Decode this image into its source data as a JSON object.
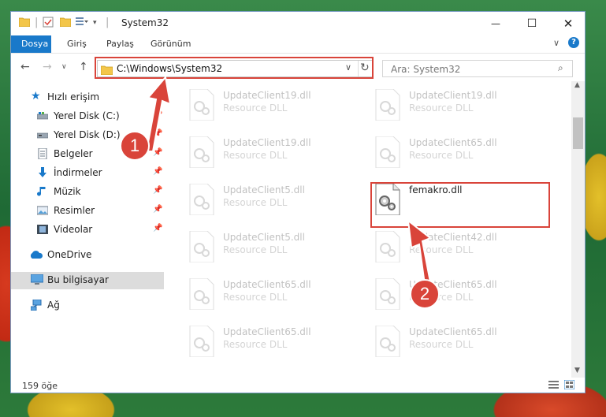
{
  "window": {
    "title": "System32",
    "minimize": "—",
    "maximize": "☐",
    "close": "✕"
  },
  "ribbon": {
    "tabs": [
      {
        "label": "Dosya",
        "active": true
      },
      {
        "label": "Giriş",
        "active": false
      },
      {
        "label": "Paylaş",
        "active": false
      },
      {
        "label": "Görünüm",
        "active": false
      }
    ]
  },
  "address": {
    "path": "C:\\Windows\\System32"
  },
  "search": {
    "placeholder": "Ara: System32"
  },
  "sidebar": {
    "items": [
      {
        "label": "Hızlı erişim",
        "icon": "star-icon",
        "pinned": false
      },
      {
        "label": "Yerel Disk (C:)",
        "icon": "drive-icon",
        "pinned": true
      },
      {
        "label": "Yerel Disk (D:)",
        "icon": "drive-icon",
        "pinned": true
      },
      {
        "label": "Belgeler",
        "icon": "documents-icon",
        "pinned": true
      },
      {
        "label": "İndirmeler",
        "icon": "downloads-icon",
        "pinned": true
      },
      {
        "label": "Müzik",
        "icon": "music-icon",
        "pinned": true
      },
      {
        "label": "Resimler",
        "icon": "pictures-icon",
        "pinned": true
      },
      {
        "label": "Videolar",
        "icon": "videos-icon",
        "pinned": true
      },
      {
        "label": "OneDrive",
        "icon": "cloud-icon",
        "pinned": false
      },
      {
        "label": "Bu bilgisayar",
        "icon": "computer-icon",
        "pinned": false,
        "selected": true
      },
      {
        "label": "Ağ",
        "icon": "network-icon",
        "pinned": false
      }
    ]
  },
  "files": {
    "left": [
      {
        "name": "UpdateClient19.dll",
        "type": "Resource DLL"
      },
      {
        "name": "UpdateClient19.dll",
        "type": "Resource DLL"
      },
      {
        "name": "UpdateClient5.dll",
        "type": "Resource DLL"
      },
      {
        "name": "UpdateClient5.dll",
        "type": "Resource DLL"
      },
      {
        "name": "UpdateClient65.dll",
        "type": "Resource DLL"
      },
      {
        "name": "UpdateClient65.dll",
        "type": "Resource DLL"
      }
    ],
    "right": [
      {
        "name": "UpdateClient19.dll",
        "type": "Resource DLL"
      },
      {
        "name": "UpdateClient65.dll",
        "type": "Resource DLL"
      },
      {
        "name": "femakro.dll",
        "type": "",
        "highlighted": true
      },
      {
        "name": "UpdateClient42.dll",
        "type": "Resource DLL"
      },
      {
        "name": "UpdateClient65.dll",
        "type": "Resource DLL"
      },
      {
        "name": "UpdateClient65.dll",
        "type": "Resource DLL"
      }
    ]
  },
  "status": {
    "count": "159 öğe"
  },
  "annotations": {
    "step1": "1",
    "step2": "2",
    "color": "#d9443a"
  }
}
